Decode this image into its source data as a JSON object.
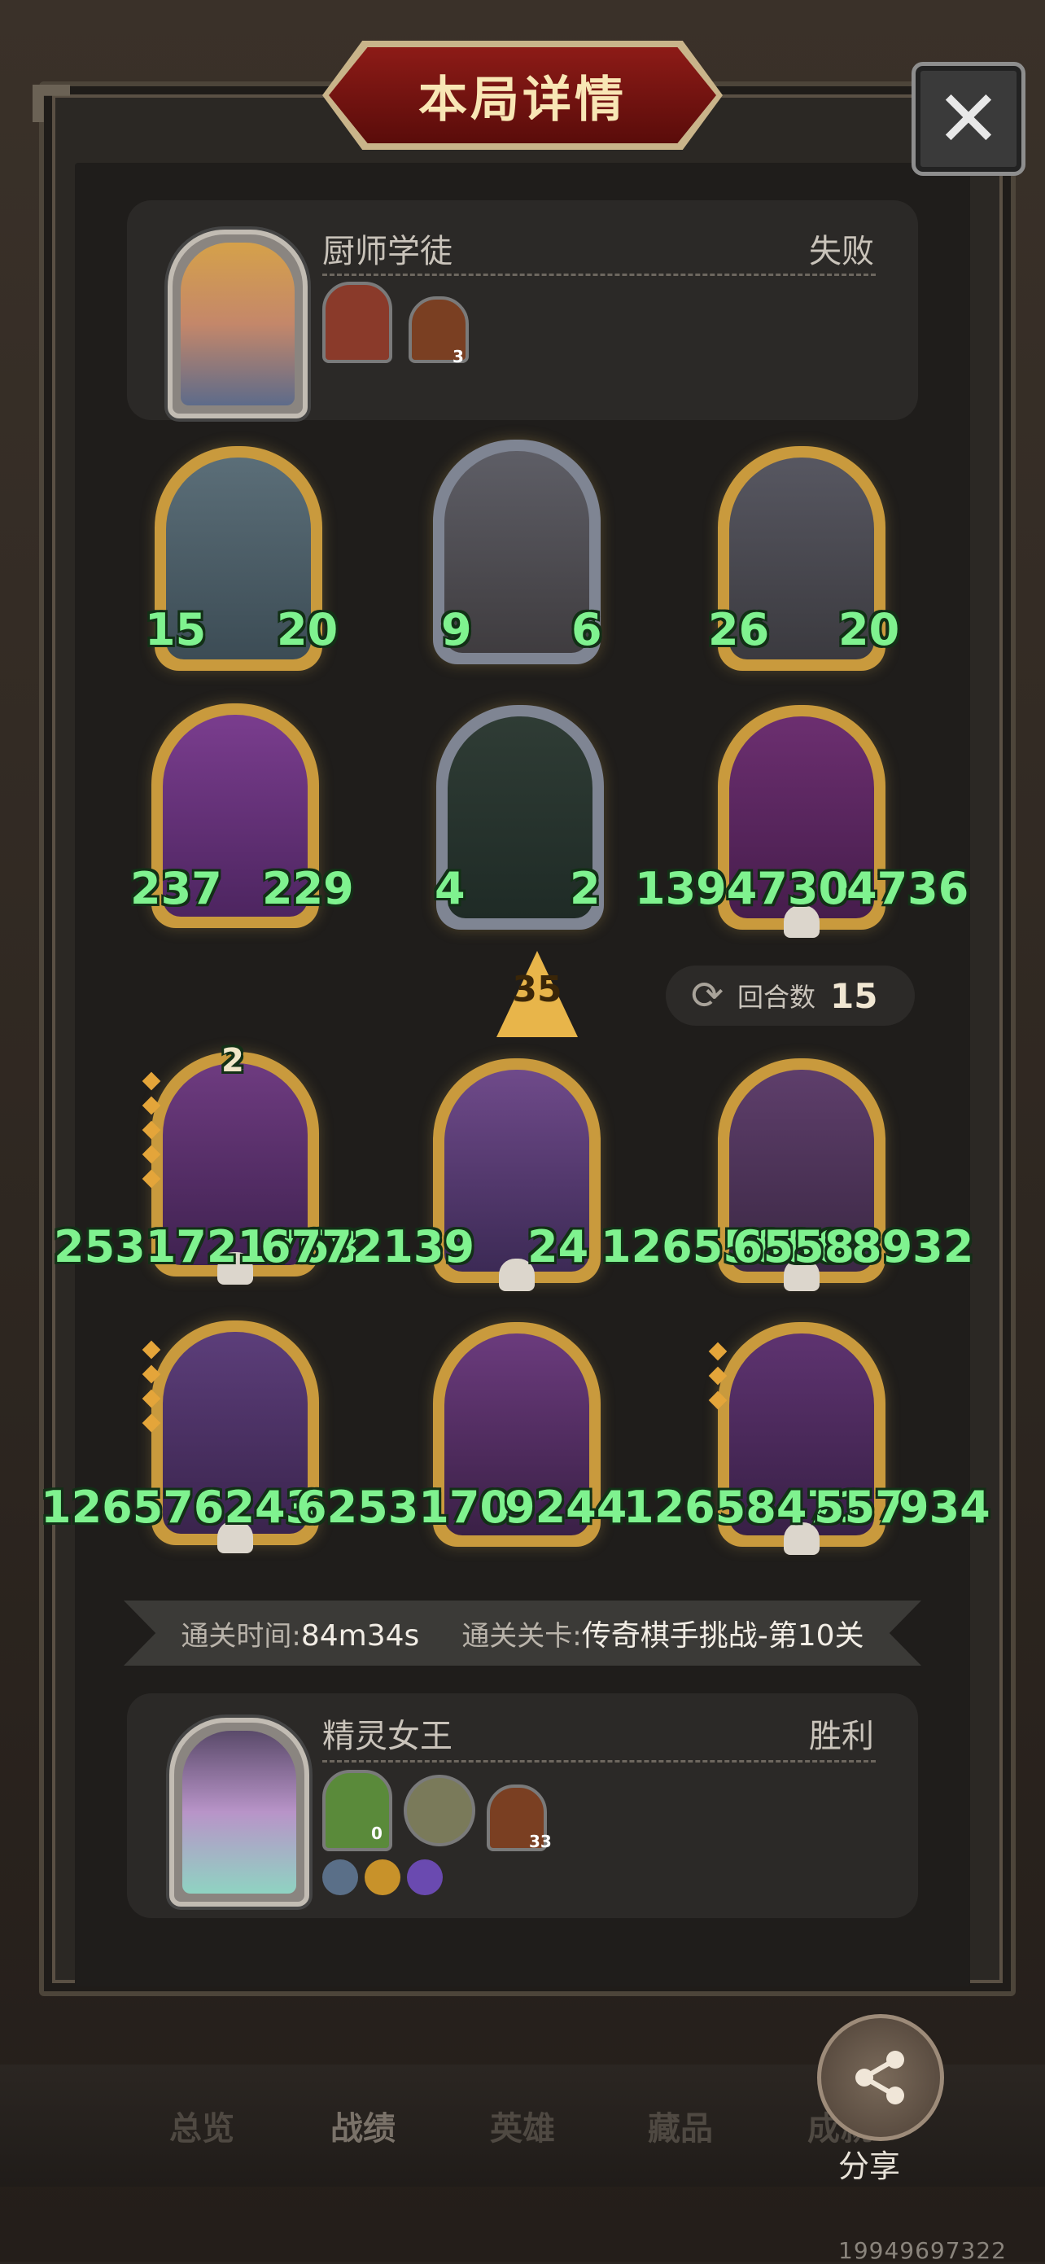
{
  "title": "本局详情",
  "close_icon": "close-icon",
  "opponent": {
    "name": "厨师学徒",
    "result": "失败",
    "items": [
      {
        "icon": "chef-card-icon",
        "count": ""
      },
      {
        "icon": "house-icon",
        "count": "3"
      }
    ]
  },
  "opponent_units": [
    {
      "atk": "15",
      "hp": "20"
    },
    {
      "atk": "9",
      "hp": "6"
    },
    {
      "atk": "26",
      "hp": "20"
    },
    {
      "atk": "237",
      "hp": "229"
    },
    {
      "atk": "4",
      "hp": "2"
    },
    {
      "atk": "1394730",
      "hp": "4736"
    }
  ],
  "level": "35",
  "round": {
    "label": "回合数",
    "value": "15"
  },
  "player_units": [
    {
      "stack": "2",
      "atk": "2531721768",
      "hp": "6772139"
    },
    {
      "atk": "24",
      "hp": "12655886"
    },
    {
      "atk": "6558",
      "hp": "8932"
    },
    {
      "atk": "126576243",
      "hp": "6253170"
    },
    {
      "atk": "9244",
      "hp": "12658471"
    },
    {
      "atk": "557",
      "hp": "934"
    }
  ],
  "clear": {
    "time_label": "通关时间:",
    "time_value": "84m34s",
    "stage_label": "通关关卡:",
    "stage_value": "传奇棋手挑战-第10关"
  },
  "player": {
    "name": "精灵女王",
    "result": "胜利",
    "items": [
      {
        "icon": "green-relic-icon",
        "count": "0"
      },
      {
        "icon": "cauldron-icon",
        "count": ""
      },
      {
        "icon": "house-icon",
        "count": "33"
      }
    ],
    "badges": [
      "sword-badge-icon",
      "gold-badge-icon",
      "purple-badge-icon"
    ]
  },
  "nav": [
    "总览",
    "战绩",
    "英雄",
    "藏品",
    "成就"
  ],
  "share_label": "分享",
  "uid": "19949697322"
}
